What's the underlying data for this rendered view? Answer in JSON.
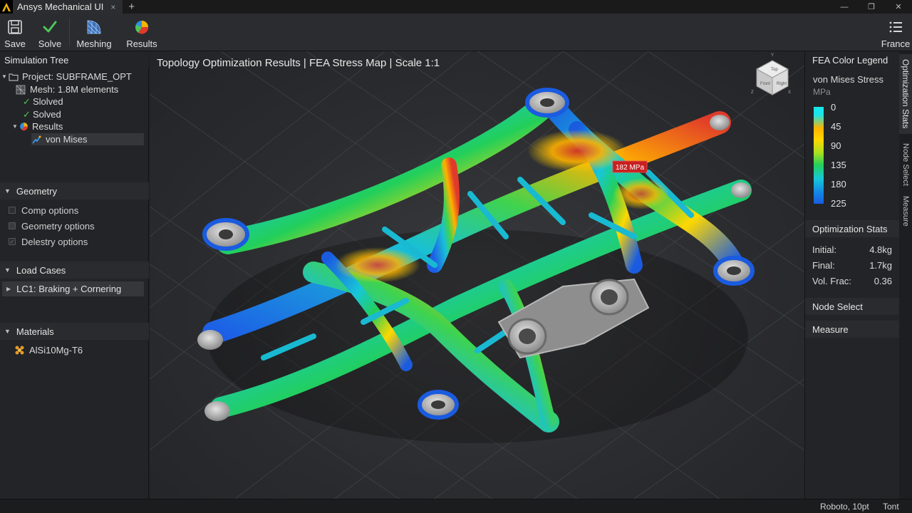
{
  "window": {
    "tab_title": "Ansys Mechanical UI",
    "tab_close": "×",
    "tab_add": "+",
    "minimize": "—",
    "restore": "❐",
    "close": "✕"
  },
  "toolbar": {
    "save_label": "Save",
    "solve_label": "Solve",
    "meshing_label": "Meshing",
    "results_label": "Results",
    "menu_label": "France"
  },
  "tree": {
    "header": "Simulation Tree",
    "project": "Project: SUBFRAME_OPT",
    "mesh": "Mesh: 1.8M elements",
    "solved_1": "Slolved",
    "solved_2": "Solved",
    "results": "Results",
    "von_mises": "von Mises"
  },
  "geometry": {
    "header": "Geometry",
    "options": [
      "Comp options",
      "Geometry options",
      "Delestry options"
    ]
  },
  "load_cases": {
    "header": "Load Cases",
    "item": "LC1: Braking + Cornering"
  },
  "materials": {
    "header": "Materials",
    "item": "AlSi10Mg-T6"
  },
  "viewport": {
    "title": "Topology Optimization Results | FEA Stress Map | Scale 1:1",
    "callout": "182 MPa",
    "cube_labels": [
      "Top",
      "Front",
      "Right"
    ],
    "axis_labels": [
      "Y",
      "X",
      "Z"
    ]
  },
  "legend": {
    "header": "FEA Color Legend",
    "quantity": "von Mises Stress",
    "unit": "MPa",
    "ticks": [
      "0",
      "45",
      "90",
      "135",
      "180",
      "225"
    ]
  },
  "stats": {
    "header": "Optimization Stats",
    "rows": [
      {
        "label": "Initial:",
        "value": "4.8kg"
      },
      {
        "label": "Final:",
        "value": "1.7kg"
      },
      {
        "label": "Vol. Frac:",
        "value": "0.36"
      }
    ]
  },
  "node_select": "Node Select",
  "measure": "Measure",
  "side_tabs": [
    "Optimization Stats",
    "Node Select",
    "Measure"
  ],
  "status": {
    "font": "Roboto, 10pt",
    "extra": "Tont"
  },
  "colors": {
    "stress_low": "#1a5be0",
    "stress_mid": "#22cf5a",
    "stress_high": "#ffb300",
    "stress_peak": "#e03a2a",
    "callout_bg": "#c82020",
    "check_green": "#4cc65a"
  }
}
